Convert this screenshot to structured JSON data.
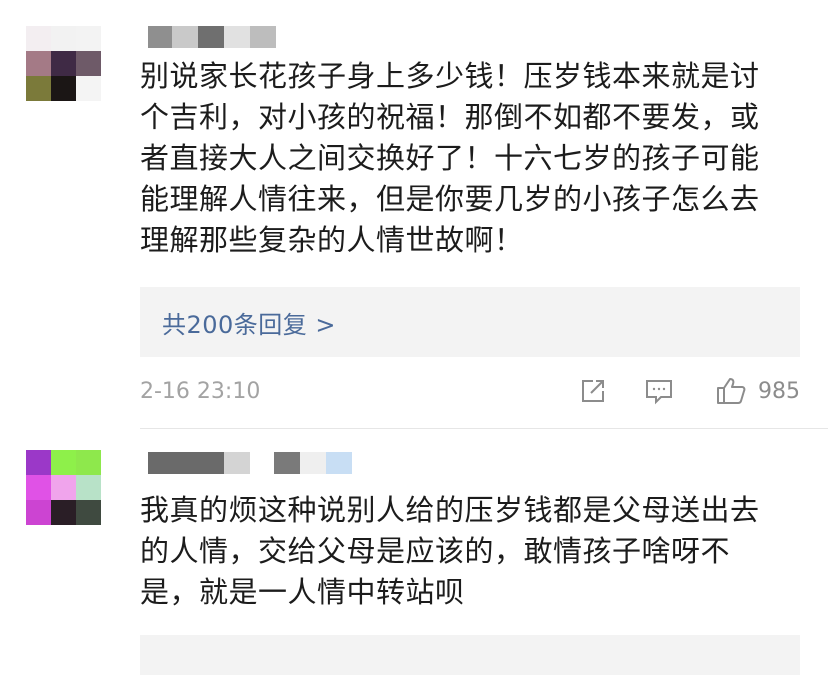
{
  "comments": [
    {
      "avatar_colors": [
        "#f3eef1",
        "#f2f2f2",
        "#f3f3f3",
        "#a47a86",
        "#3f2a45",
        "#6e5a68",
        "#7b7a3a",
        "#1b1615",
        "#f4f4f4"
      ],
      "username_blocks": [
        "#8f8f8f",
        "#c9c9c9",
        "#6f6f6f",
        "#e1e1e1",
        "#bdbdbd"
      ],
      "content_lines": [
        "别说家长花孩子身上多少钱！压岁钱本来就是讨",
        "个吉利，对小孩的祝福！那倒不如都不要发，或",
        "者直接大人之间交换好了！十六七岁的孩子可能",
        "能理解人情往来，但是你要几岁的小孩子怎么去",
        "理解那些复杂的人情世故啊！"
      ],
      "replies_label": "共200条回复 >",
      "timestamp": "2-16 23:10",
      "share_icon": "share-icon",
      "reply_icon": "comment-icon",
      "like_icon": "thumbs-up-icon",
      "like_count": "985"
    },
    {
      "avatar_colors": [
        "#9b38c8",
        "#8ef04a",
        "#8ee84c",
        "#e052e6",
        "#f0a4ec",
        "#b8e2c8",
        "#cc44d2",
        "#2a1e26",
        "#3f4a40"
      ],
      "username_blocks": [
        "#6a6a6a",
        "#d4d4d4",
        "#7a7a7a",
        "#efefef",
        "#c8def4"
      ],
      "content_lines": [
        "我真的烦这种说别人给的压岁钱都是父母送出去",
        "的人情，交给父母是应该的，敢情孩子啥呀不",
        "是，就是一人情中转站呗"
      ]
    }
  ],
  "colors": {
    "link": "#4a6a9a",
    "meta_text": "#a3a3a3",
    "icon": "#8c8c8c",
    "reply_background": "#f3f3f3"
  }
}
